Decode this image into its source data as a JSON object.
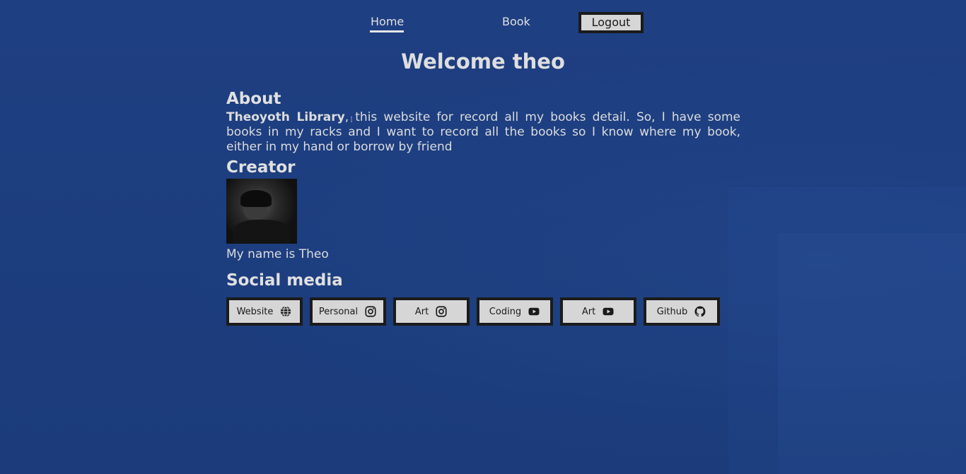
{
  "nav": {
    "home_label": "Home",
    "book_label": "Book",
    "logout_label": "Logout"
  },
  "page": {
    "title": "Welcome theo"
  },
  "about": {
    "heading": "About",
    "brand": "Theoyoth Library",
    "text": ", this website for record all my books detail. So, I have some books in my racks and I want to record all the books so I know where my book, either in my hand or borrow by friend"
  },
  "creator": {
    "heading": "Creator",
    "name_text": "My name is Theo"
  },
  "social": {
    "heading": "Social media",
    "buttons": [
      {
        "label": "Website",
        "icon": "globe-icon"
      },
      {
        "label": "Personal",
        "icon": "instagram-icon"
      },
      {
        "label": "Art",
        "icon": "instagram-icon"
      },
      {
        "label": "Coding",
        "icon": "youtube-icon"
      },
      {
        "label": "Art",
        "icon": "youtube-icon"
      },
      {
        "label": "Github",
        "icon": "github-icon"
      }
    ]
  },
  "colors": {
    "background": "#1d3d7e",
    "button_bg": "#d6d6d6",
    "button_border": "#1b1b1b",
    "text": "#d9d9d9"
  }
}
